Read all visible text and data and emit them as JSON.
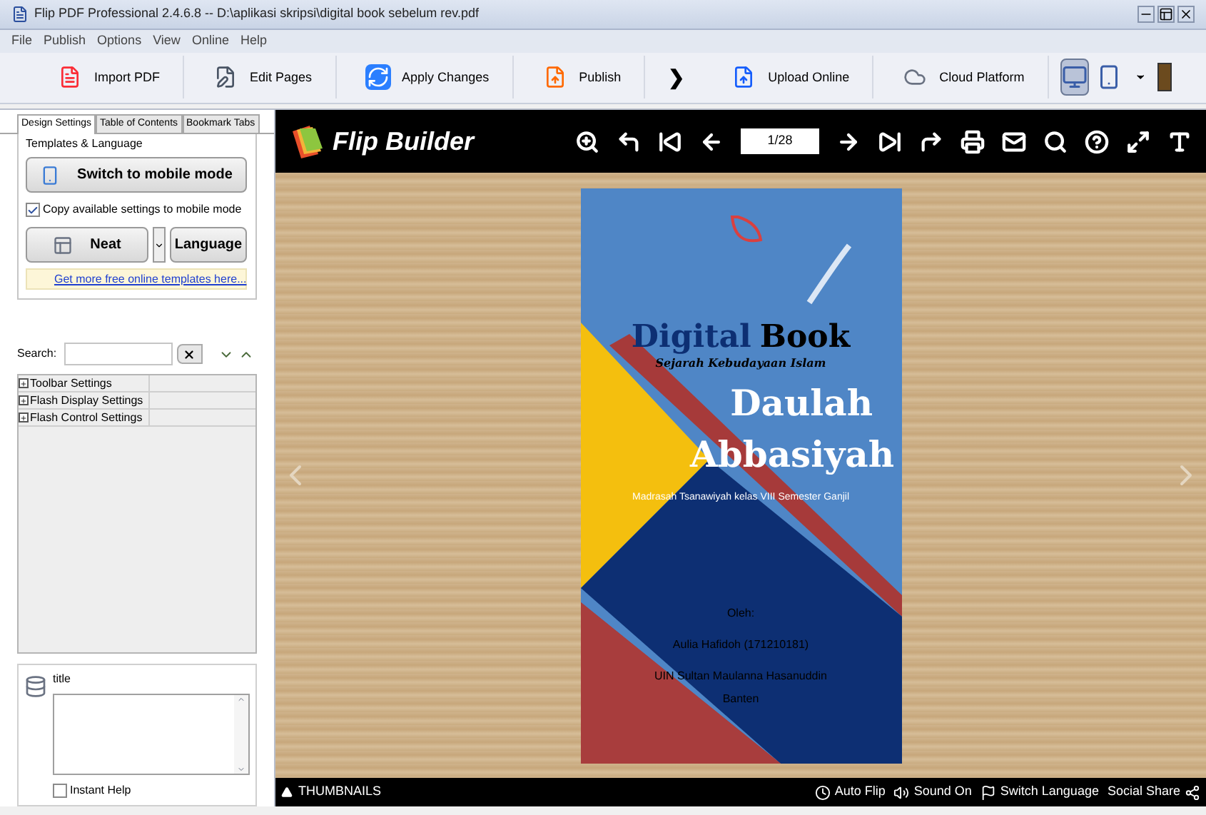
{
  "window": {
    "title": "Flip PDF Professional 2.4.6.8 -- D:\\aplikasi skripsi\\digital book sebelum rev.pdf"
  },
  "menu": [
    "File",
    "Publish",
    "Options",
    "View",
    "Online",
    "Help"
  ],
  "toolbar": [
    {
      "kind": "pdf",
      "label": "Import PDF"
    },
    {
      "kind": "edit",
      "label": "Edit Pages"
    },
    {
      "kind": "apply",
      "label": "Apply Changes"
    },
    {
      "kind": "publish",
      "label": "Publish"
    },
    {
      "kind": "chevron",
      "label": "❯"
    },
    {
      "kind": "upload",
      "label": "Upload Online"
    },
    {
      "kind": "cloud",
      "label": "Cloud Platform"
    }
  ],
  "view_modes": [
    {
      "kind": "desktop",
      "selected": true
    },
    {
      "kind": "mobile",
      "selected": false
    }
  ],
  "panel": {
    "tabs": [
      {
        "label": "Design Settings",
        "selected": true
      },
      {
        "label": "Table of Contents",
        "selected": false
      },
      {
        "label": "Bookmark Tabs",
        "selected": false
      }
    ],
    "group_title": "Templates & Language",
    "mobile_button": "Switch to mobile mode",
    "copy_settings": {
      "label": "Copy available settings to mobile mode",
      "checked": true
    },
    "template_button": "Neat",
    "language_button": "Language",
    "templates_link": "Get more free online templates here...",
    "search_label": "Search:",
    "settings": [
      {
        "label": "Toolbar Settings",
        "expanded": false
      },
      {
        "label": "Flash Display Settings",
        "expanded": false
      },
      {
        "label": "Flash Control Settings",
        "expanded": false
      }
    ],
    "help_title": "title",
    "instant_help": {
      "label": "Instant Help",
      "checked": false
    }
  },
  "viewer": {
    "brand": "Flip Builder",
    "page": "1/28",
    "cover": {
      "heading_1": "Digital",
      "heading_2": "Book",
      "subject": "Sejarah Kebudayaan Islam",
      "title_1": "Daulah",
      "title_2": "Abbasiyah",
      "school": "Madrasah Tsanawiyah kelas VIII Semester Ganjil",
      "by": "Oleh:",
      "author": "Aulia Hafidoh (171210181)",
      "university": "UIN Sultan Maulanna Hasanuddin Banten"
    },
    "thumbnails": "THUMBNAILS",
    "bottom": [
      {
        "kind": "autoflip",
        "label": "Auto Flip"
      },
      {
        "kind": "sound",
        "label": "Sound On"
      },
      {
        "kind": "language",
        "label": "Switch Language"
      },
      {
        "kind": "share",
        "label": "Social Share"
      }
    ]
  }
}
